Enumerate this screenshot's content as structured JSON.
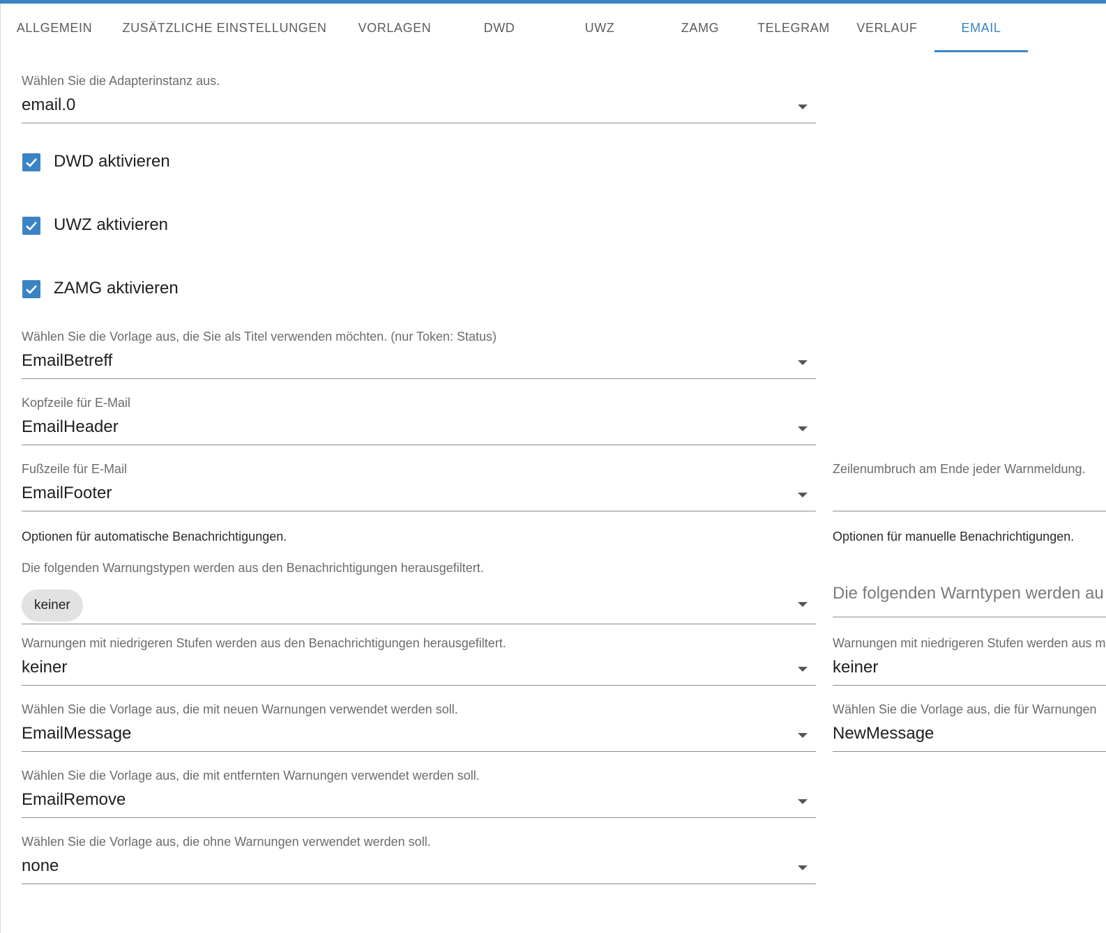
{
  "tabs": [
    {
      "label": "ALLGEMEIN"
    },
    {
      "label": "ZUSÄTZLICHE EINSTELLUNGEN"
    },
    {
      "label": "VORLAGEN"
    },
    {
      "label": "DWD"
    },
    {
      "label": "UWZ"
    },
    {
      "label": "ZAMG"
    },
    {
      "label": "TELEGRAM"
    },
    {
      "label": "VERLAUF"
    },
    {
      "label": "EMAIL"
    }
  ],
  "active_tab": "EMAIL",
  "accent_color": "#3a84c4",
  "instance": {
    "label": "Wählen Sie die Adapterinstanz aus.",
    "value": "email.0"
  },
  "checkboxes": [
    {
      "label": "DWD aktivieren",
      "checked": true
    },
    {
      "label": "UWZ aktivieren",
      "checked": true
    },
    {
      "label": "ZAMG aktivieren",
      "checked": true
    }
  ],
  "title_template": {
    "label": "Wählen Sie die Vorlage aus, die Sie als Titel verwenden möchten. (nur Token: Status)",
    "value": "EmailBetreff"
  },
  "header_template": {
    "label": "Kopfzeile für E-Mail",
    "value": "EmailHeader"
  },
  "footer_template": {
    "label": "Fußzeile für E-Mail",
    "value": "EmailFooter"
  },
  "line_break": {
    "label": "Zeilenumbruch am Ende jeder Warnmeldung.",
    "value": ""
  },
  "auto": {
    "heading": "Optionen für automatische Benachrichtigungen.",
    "filter_types": {
      "label": "Die folgenden Warnungstypen werden aus den Benachrichtigungen herausgefiltert.",
      "chip": "keiner"
    },
    "filter_level": {
      "label": "Warnungen mit niedrigeren Stufen werden aus den Benachrichtigungen herausgefiltert.",
      "value": "keiner"
    },
    "new_template": {
      "label": "Wählen Sie die Vorlage aus, die mit neuen Warnungen verwendet werden soll.",
      "value": "EmailMessage"
    },
    "removed_template": {
      "label": "Wählen Sie die Vorlage aus, die mit entfernten Warnungen verwendet werden soll.",
      "value": "EmailRemove"
    },
    "none_template": {
      "label": "Wählen Sie die Vorlage aus, die ohne Warnungen verwendet werden soll.",
      "value": "none"
    }
  },
  "manual": {
    "heading": "Optionen für manuelle Benachrichtigungen.",
    "filter_types": {
      "placeholder": "Die folgenden Warntypen werden au"
    },
    "filter_level": {
      "label": "Warnungen mit niedrigeren Stufen werden aus m",
      "value": "keiner"
    },
    "template": {
      "label": "Wählen Sie die Vorlage aus, die für Warnungen",
      "value": "NewMessage"
    }
  }
}
